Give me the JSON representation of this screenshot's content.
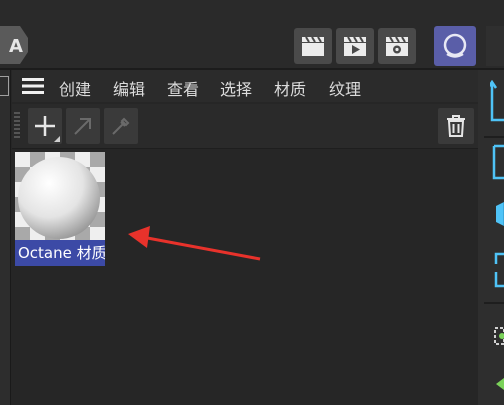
{
  "menu": {
    "items": [
      "创建",
      "编辑",
      "查看",
      "选择",
      "材质",
      "纹理"
    ]
  },
  "material": {
    "name": "Octane 材质"
  },
  "icons": {
    "top_left": "letter-a-icon",
    "menu": "hamburger-menu-icon",
    "add": "plus-icon",
    "link": "arrow-diagonal-icon",
    "eyedropper": "eyedropper-icon",
    "delete": "trash-icon",
    "render_view": "clapperboard-icon",
    "render_play": "render-play-icon",
    "render_settings": "render-settings-icon",
    "octane": "octane-logo-icon"
  },
  "colors": {
    "background": "#262626",
    "selection": "#3c4aa6",
    "octane_button": "#5a5ea8",
    "annotation_arrow": "#e8322b",
    "right_icon_accent": "#4fc3f7"
  }
}
